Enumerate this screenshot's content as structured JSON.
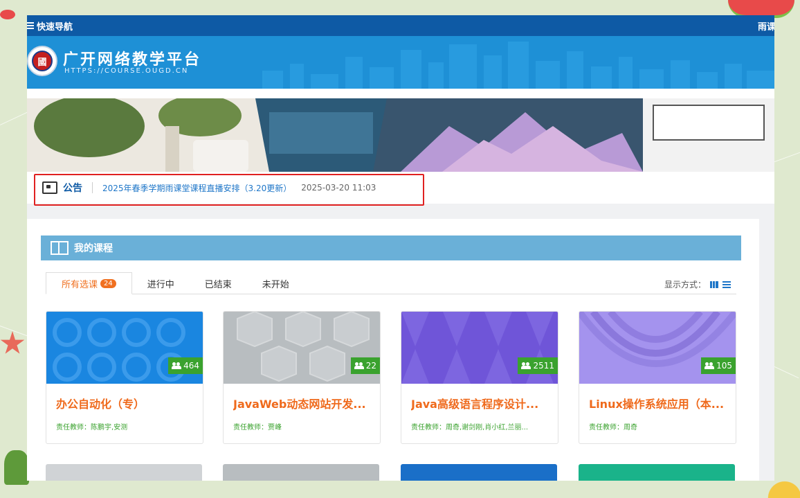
{
  "topbar": {
    "nav_label": "快速导航",
    "right_label": "雨课"
  },
  "header": {
    "title": "广开网络教学平台",
    "url": "HTTPS://COURSE.OUGD.CN",
    "seal_char": "國"
  },
  "notice": {
    "label": "公告",
    "link": "2025年春季学期雨课堂课程直播安排（3.20更新）",
    "date": "2025-03-20 11:03"
  },
  "courses": {
    "title": "我的课程",
    "tabs": [
      {
        "label": "所有选课",
        "badge": "24"
      },
      {
        "label": "进行中"
      },
      {
        "label": "已结束"
      },
      {
        "label": "未开始"
      }
    ],
    "display_mode_label": "显示方式：",
    "cards": [
      {
        "title": "办公自动化（专）",
        "teacher": "责任教师：陈鹏宇,安测",
        "count": "464",
        "color": "#1a86e0"
      },
      {
        "title": "JavaWeb动态网站开发...",
        "teacher": "责任教师：贾峰",
        "count": "22",
        "color": "#b8bdc0"
      },
      {
        "title": "Java高级语言程序设计...",
        "teacher": "责任教师：周奇,谢剑刚,肖小红,兰丽...",
        "count": "2511",
        "color": "#6f55d8"
      },
      {
        "title": "Linux操作系统应用（本...",
        "teacher": "责任教师：周奇",
        "count": "105",
        "color": "#a493ee"
      }
    ],
    "row2_colors": [
      "#d0d3d6",
      "#b8bdc0",
      "#1a6fc8",
      "#1ab38a"
    ]
  }
}
